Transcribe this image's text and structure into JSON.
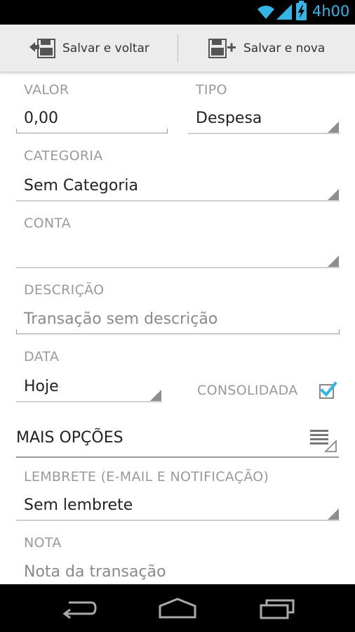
{
  "status_bar": {
    "time": "4h00",
    "accent": "#33b5e5"
  },
  "action_bar": {
    "save_back_label": "Salvar e voltar",
    "save_new_label": "Salvar e nova"
  },
  "form": {
    "valor": {
      "label": "VALOR",
      "value": "0,00"
    },
    "tipo": {
      "label": "TIPO",
      "value": "Despesa"
    },
    "categoria": {
      "label": "CATEGORIA",
      "value": "Sem Categoria"
    },
    "conta": {
      "label": "CONTA",
      "value": ""
    },
    "descricao": {
      "label": "DESCRIÇÃO",
      "placeholder": "Transação sem descrição"
    },
    "data": {
      "label": "DATA",
      "value": "Hoje"
    },
    "consolidada": {
      "label": "CONSOLIDADA",
      "checked": true
    },
    "mais_opcoes": {
      "title": "MAIS OPÇÕES"
    },
    "lembrete": {
      "label": "LEMBRETE (E-MAIL E NOTIFICAÇÃO)",
      "value": "Sem lembrete"
    },
    "nota": {
      "label": "NOTA",
      "placeholder": "Nota da transação"
    }
  },
  "nav_bar": {
    "icons": [
      "back-icon",
      "home-icon",
      "recent-apps-icon"
    ]
  }
}
